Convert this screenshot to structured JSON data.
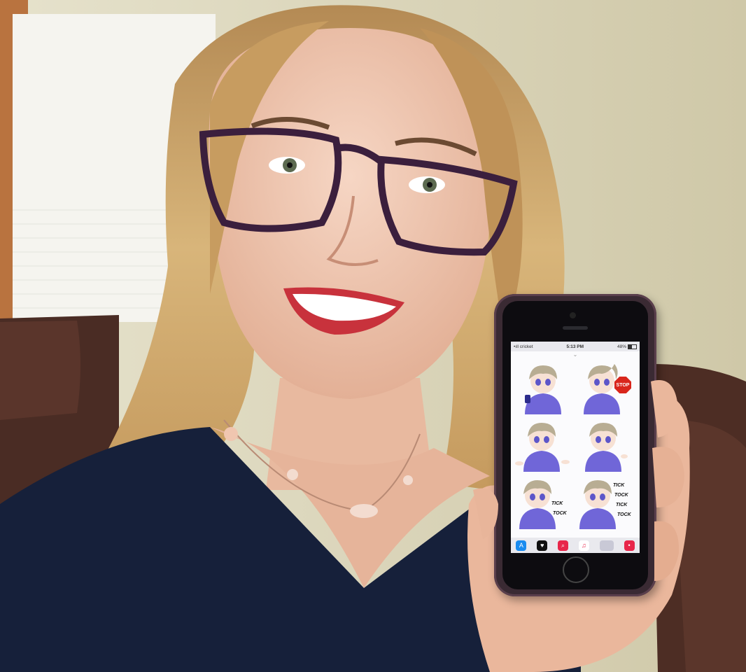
{
  "phone": {
    "status": {
      "carrier": "•ıll cricket",
      "time": "5:13 PM",
      "battery": "48%"
    },
    "grab_handle": "⌄",
    "stickers": [
      {
        "name": "sticker-phone"
      },
      {
        "name": "sticker-stop",
        "sign": "STOP"
      },
      {
        "name": "sticker-shrug"
      },
      {
        "name": "sticker-point"
      },
      {
        "name": "sticker-tick-tock-1",
        "words": [
          "TICK",
          "TOCK"
        ]
      },
      {
        "name": "sticker-tick-tock-2",
        "words": [
          "TICK",
          "TOCK",
          "TICK",
          "TOCK"
        ]
      }
    ],
    "tray_icons": [
      "app-store-icon",
      "digital-touch-icon",
      "image-search-icon",
      "music-icon",
      "sticker-pack-icon",
      "more-apps-icon"
    ]
  },
  "colors": {
    "wall": "#d9d3b6",
    "couch": "#4a2a22",
    "shirt": "#16203a",
    "hair": "#c9a36a",
    "glasses": "#3b1f3d",
    "lips": "#c8323c",
    "sticker_shirt": "#7066d8",
    "sticker_hair": "#b8ad93"
  }
}
